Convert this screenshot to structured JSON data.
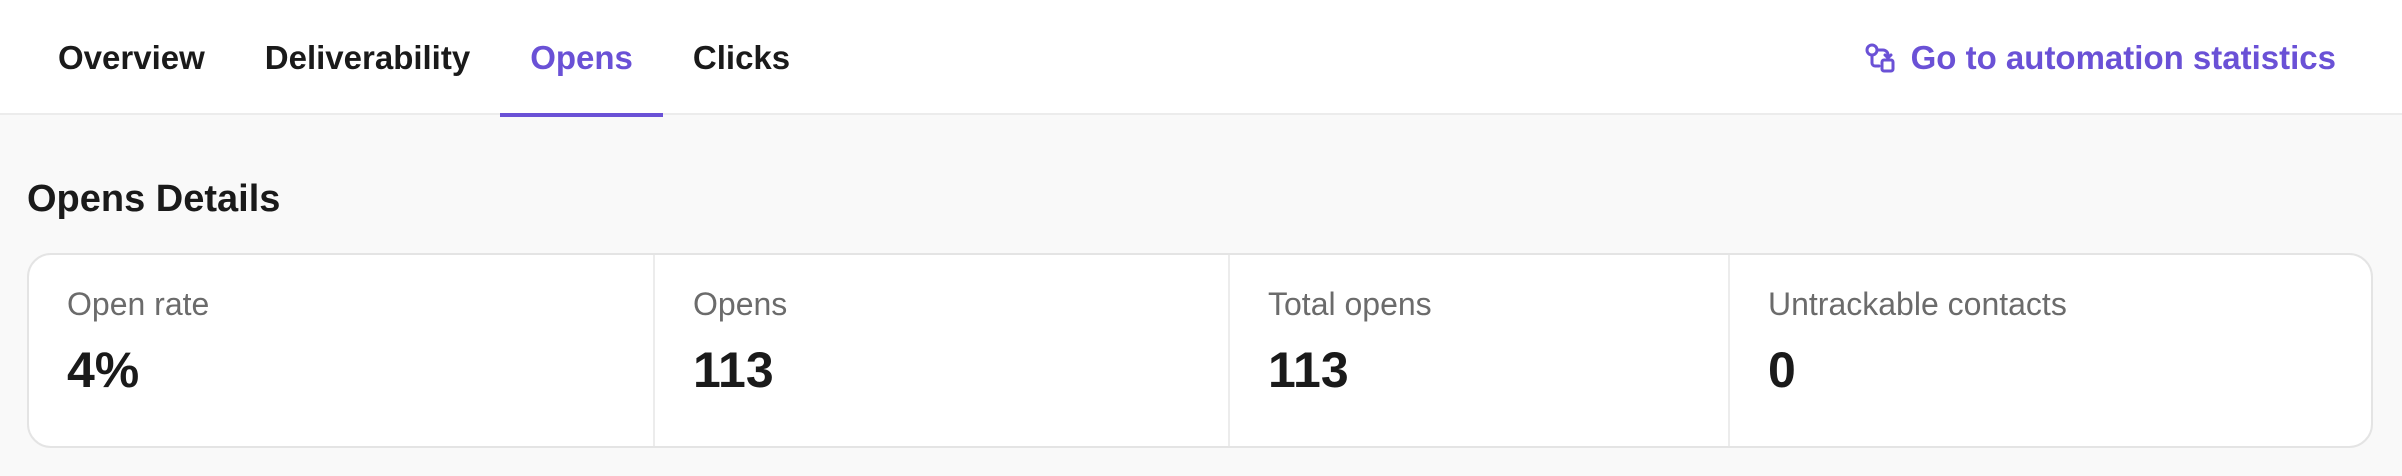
{
  "tabs": [
    {
      "label": "Overview",
      "active": false
    },
    {
      "label": "Deliverability",
      "active": false
    },
    {
      "label": "Opens",
      "active": true
    },
    {
      "label": "Clicks",
      "active": false
    }
  ],
  "automation_link": {
    "label": "Go to automation statistics",
    "icon": "automation-icon"
  },
  "section": {
    "title": "Opens Details"
  },
  "stats": [
    {
      "label": "Open rate",
      "value": "4%"
    },
    {
      "label": "Opens",
      "value": "113"
    },
    {
      "label": "Total opens",
      "value": "113"
    },
    {
      "label": "Untrackable contacts",
      "value": "0"
    }
  ],
  "colors": {
    "accent": "#6a51d6",
    "background": "#f9f9f9",
    "text": "#1a1a1a",
    "muted": "#6b6b6b"
  }
}
